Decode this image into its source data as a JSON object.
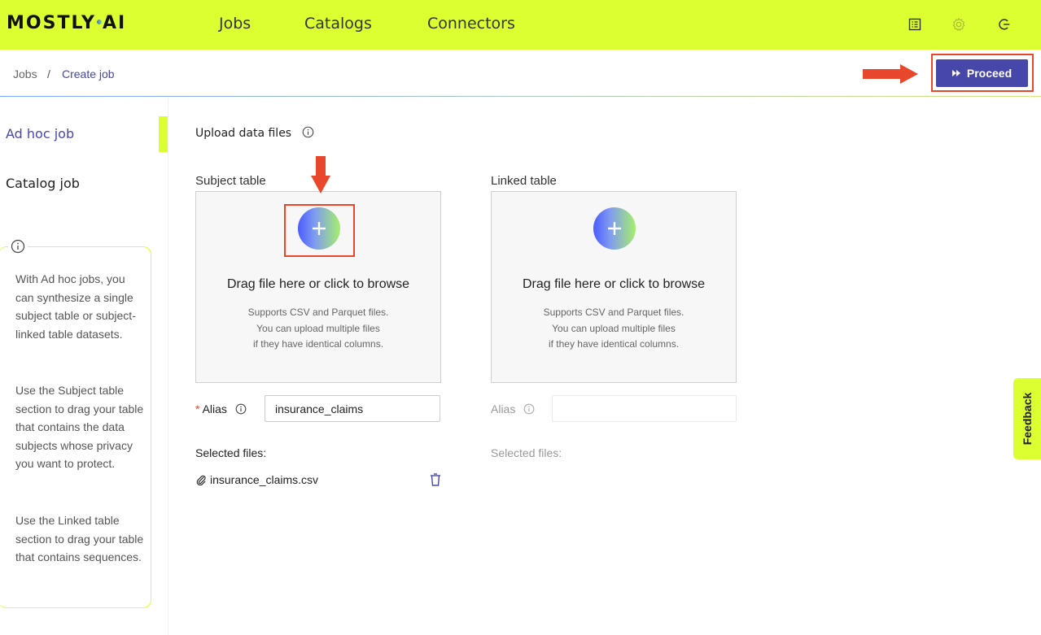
{
  "brand": {
    "logo_left": "MOSTLY",
    "logo_right": "AI"
  },
  "nav": {
    "items": [
      {
        "label": "Jobs"
      },
      {
        "label": "Catalogs"
      },
      {
        "label": "Connectors"
      }
    ]
  },
  "header_icons": [
    "document-list-icon",
    "gear-icon",
    "logout-icon"
  ],
  "breadcrumb": {
    "root": "Jobs",
    "separator": "/",
    "current": "Create job"
  },
  "proceed": {
    "label": "Proceed"
  },
  "sidebar": {
    "tabs": [
      {
        "label": "Ad hoc job",
        "active": true
      },
      {
        "label": "Catalog job",
        "active": false
      }
    ],
    "info": {
      "paragraphs": [
        "With Ad hoc jobs, you can synthesize a single subject table or subject-linked table datasets.",
        "Use the Subject table section to drag your table that contains the data subjects whose privacy you want to protect.",
        "Use the Linked table section to drag your table that contains sequences."
      ]
    }
  },
  "upload": {
    "title": "Upload data files",
    "subject": {
      "label": "Subject table",
      "drop_title": "Drag file here or click to browse",
      "drop_sub": [
        "Supports CSV and Parquet files.",
        "You can upload multiple files",
        "if they have identical columns."
      ],
      "alias_required_mark": "*",
      "alias_label": "Alias",
      "alias_value": "insurance_claims",
      "selected_files_label": "Selected files:",
      "files": [
        "insurance_claims.csv"
      ]
    },
    "linked": {
      "label": "Linked table",
      "drop_title": "Drag file here or click to browse",
      "drop_sub": [
        "Supports CSV and Parquet files.",
        "You can upload multiple files",
        "if they have identical columns."
      ],
      "alias_label": "Alias",
      "alias_value": "",
      "selected_files_label": "Selected files:"
    }
  },
  "feedback": {
    "label": "Feedback"
  },
  "colors": {
    "brand_lime": "#dbff30",
    "primary": "#4647a8",
    "annotation_red": "#e8472c"
  }
}
